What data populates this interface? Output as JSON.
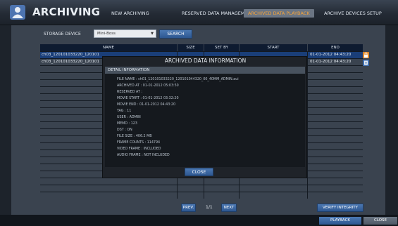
{
  "header": {
    "title": "ARCHIVING",
    "tabs": [
      {
        "label": "NEW ARCHIVING",
        "active": false
      },
      {
        "label": "RESERVED DATA MANAGEMENT",
        "active": false
      },
      {
        "label": "ARCHIVED DATA PLAYBACK",
        "active": true
      },
      {
        "label": "ARCHIVE DEVICES SETUP",
        "active": false
      }
    ]
  },
  "storage": {
    "label": "STORAGE DEVICE",
    "selected": "Mini-Boss",
    "search_label": "SEARCH"
  },
  "table": {
    "columns": [
      "NAME",
      "SIZE",
      "SET BY",
      "START",
      "END"
    ],
    "rows": [
      {
        "name": "ch03_120101033220_120101",
        "end": "01-01-2012 04:43:20",
        "selected": true
      },
      {
        "name": "ch03_120101033220_120101",
        "end": "01-01-2012 04:43:20",
        "selected": false
      }
    ]
  },
  "pagination": {
    "prev": "PREV.",
    "page": "1/1",
    "next": "NEXT"
  },
  "verify_label": "VERIFY INTEGRITY",
  "footer": {
    "playback": "PLAYBACK",
    "close": "CLOSE"
  },
  "modal": {
    "title": "ARCHIVED DATA INFORMATION",
    "section": "DETAIL INFORMATION",
    "lines": [
      "FILE NAME : ch01_120101033220_120101044320_00_40MM_ADMIN.aui",
      "ARCHIVED AT : 01-01-2012 05:03:50",
      "RESERVED AT :",
      "MOVIE START : 01-01-2012 03:32:20",
      "MOVIE END : 01-01-2012 04:43:20",
      "TAG : 11",
      "USER : ADMIN",
      "MEMO : 123",
      "DST : ON",
      "FILE SIZE : 406.2 MB",
      "FRAME COUNTS : 114794",
      "VIDEO FRAME : INCLUDED",
      "AUDIO FRAME : NOT INCLUDED"
    ],
    "close_label": "CLOSE"
  },
  "colors": {
    "accent_tab": "#f3a33b",
    "selected_row": "#1a3e78",
    "header_row": "#0e1b30",
    "button": "#3566a3"
  }
}
